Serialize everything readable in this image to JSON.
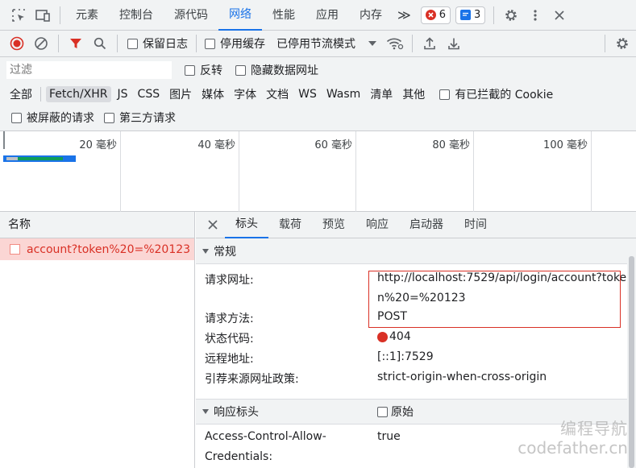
{
  "tabs": {
    "items": [
      "元素",
      "控制台",
      "源代码",
      "网络",
      "性能",
      "应用",
      "内存"
    ],
    "more": "≫",
    "errors": "6",
    "messages": "3"
  },
  "toolbar": {
    "preserve_log": "保留日志",
    "disable_cache": "停用缓存",
    "throttle": "已停用节流模式"
  },
  "filter": {
    "placeholder": "过滤",
    "invert": "反转",
    "hide_data_urls": "隐藏数据网址",
    "types": [
      "全部",
      "Fetch/XHR",
      "JS",
      "CSS",
      "图片",
      "媒体",
      "字体",
      "文档",
      "WS",
      "Wasm",
      "清单",
      "其他"
    ],
    "active_type": "Fetch/XHR",
    "blocked_cookies": "有已拦截的 Cookie",
    "blocked_requests": "被屏蔽的请求",
    "third_party": "第三方请求"
  },
  "timeline": {
    "labels": [
      "20 毫秒",
      "40 毫秒",
      "60 毫秒",
      "80 毫秒",
      "100 毫秒"
    ]
  },
  "requests": {
    "header": "名称",
    "items": [
      {
        "name": "account?token%20=%20123",
        "status": "error"
      }
    ]
  },
  "details": {
    "tabs": [
      "标头",
      "载荷",
      "预览",
      "响应",
      "启动器",
      "时间"
    ],
    "active_tab": "标头",
    "general": {
      "title": "常规",
      "request_url_label": "请求网址:",
      "request_url_line1": "http://localhost:7529/api/login/account?toke",
      "request_url_line2": "n%20=%20123",
      "method_label": "请求方法:",
      "method": "POST",
      "status_label": "状态代码:",
      "status": "404",
      "remote_label": "远程地址:",
      "remote": "[::1]:7529",
      "referrer_label": "引荐来源网址政策:",
      "referrer": "strict-origin-when-cross-origin"
    },
    "response_headers": {
      "title": "响应标头",
      "raw": "原始",
      "acac_label_line1": "Access-Control-Allow-",
      "acac_label_line2": "Credentials:",
      "acac_value": "true"
    }
  },
  "watermark": {
    "line1": "编程导航",
    "line2": "codefather.cn"
  },
  "colors": {
    "accent": "#1a73e8",
    "error": "#d93025",
    "record": "#d93025"
  }
}
